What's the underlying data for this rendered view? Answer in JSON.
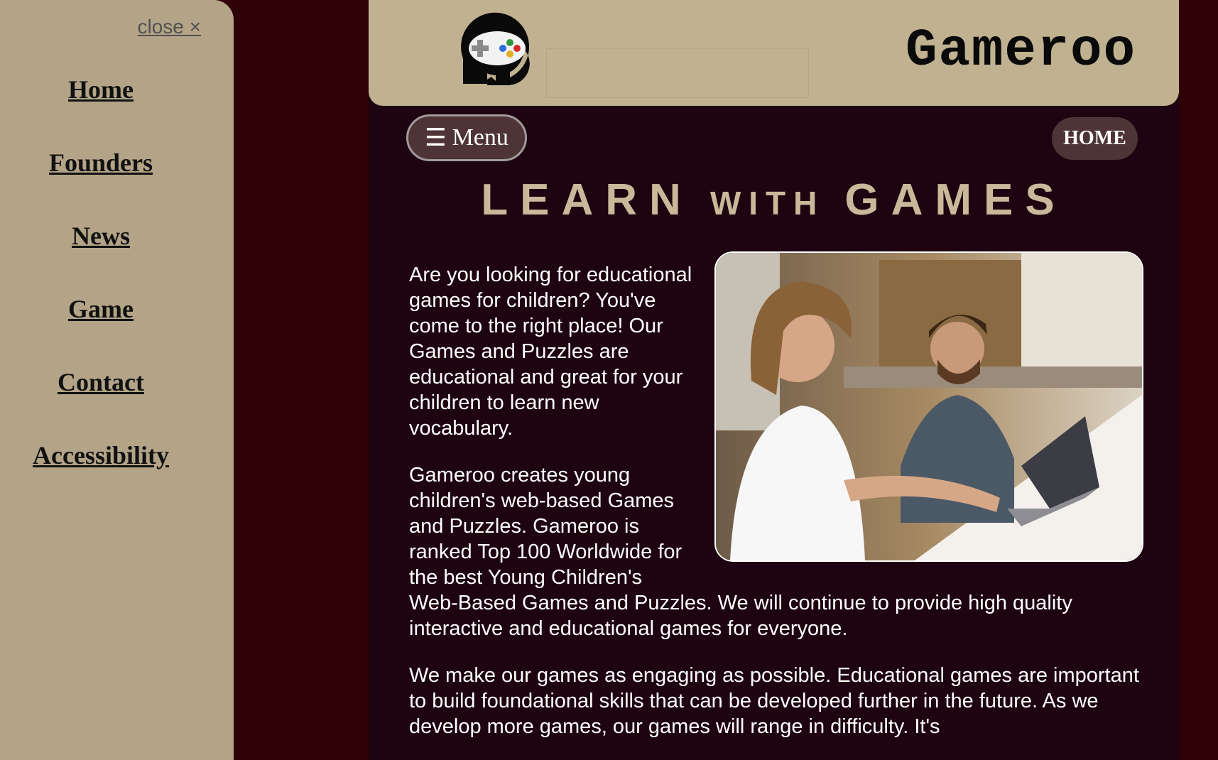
{
  "sidebar": {
    "close_label": "close ×",
    "items": [
      {
        "label": "Home"
      },
      {
        "label": "Founders"
      },
      {
        "label": "News"
      },
      {
        "label": "Game"
      },
      {
        "label": "Contact"
      },
      {
        "label": "Accessibility"
      }
    ]
  },
  "header": {
    "title": "Gameroo",
    "logo_icon": "gamepad-logo-icon"
  },
  "toolbar": {
    "menu_icon": "hamburger-icon",
    "menu_glyph": "☰",
    "menu_label": "Menu",
    "home_label": "HOME"
  },
  "heading": {
    "word1": "LEARN",
    "word2": "WITH",
    "word3": "GAMES"
  },
  "content": {
    "paragraphs": [
      "Are you looking for educational games for children? You've come to the right place! Our Games and Puzzles are educational and great for your children to learn new vocabulary.",
      "Gameroo creates young children's web-based Games and Puzzles. Gameroo is ranked Top 100 Worldwide for the best Young Children's Web-Based Games and Puzzles. We will continue to provide high quality interactive and educational games for everyone.",
      "We make our games as engaging as possible. Educational games are important to build foundational skills that can be developed further in the future. As we develop more games, our games will range in difficulty. It's"
    ]
  },
  "colors": {
    "page_bg": "#2e0206",
    "sidebar_bg": "#b4a487",
    "header_bg": "#c0b190",
    "main_bg": "#1e0310",
    "accent_text": "#c9b99a",
    "button_bg": "#4e3436"
  }
}
